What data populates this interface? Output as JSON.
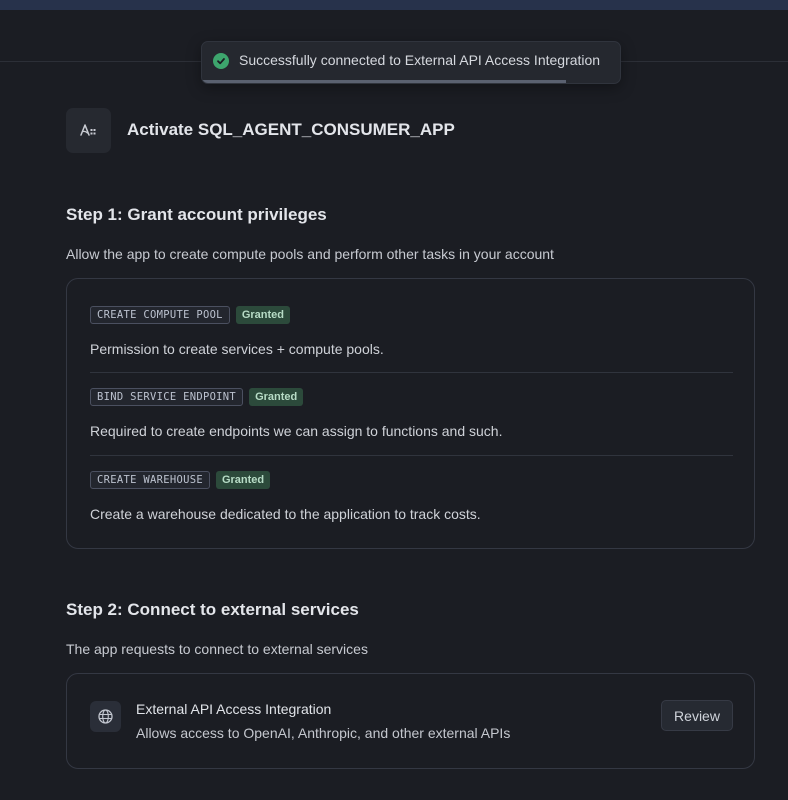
{
  "toast": {
    "message": "Successfully connected to External API Access Integration",
    "progress": 0.87
  },
  "app": {
    "title": "Activate SQL_AGENT_CONSUMER_APP",
    "icon": "app-logo-icon"
  },
  "step1": {
    "title": "Step 1: Grant account privileges",
    "description": "Allow the app to create compute pools and perform other tasks in your account",
    "privileges": [
      {
        "code": "CREATE COMPUTE POOL",
        "status": "Granted",
        "description": "Permission to create services + compute pools."
      },
      {
        "code": "BIND SERVICE ENDPOINT",
        "status": "Granted",
        "description": "Required to create endpoints we can assign to functions and such."
      },
      {
        "code": "CREATE WAREHOUSE",
        "status": "Granted",
        "description": "Create a warehouse dedicated to the application to track costs."
      }
    ]
  },
  "step2": {
    "title": "Step 2: Connect to external services",
    "description": "The app requests to connect to external services",
    "service": {
      "name": "External API Access Integration",
      "description": "Allows access to OpenAI, Anthropic, and other external APIs",
      "button": "Review",
      "icon": "globe-icon"
    }
  },
  "colors": {
    "background": "#1b1d23",
    "success": "#3da56d",
    "granted_bg": "#2c4a3b",
    "topbar": "#27324b"
  }
}
